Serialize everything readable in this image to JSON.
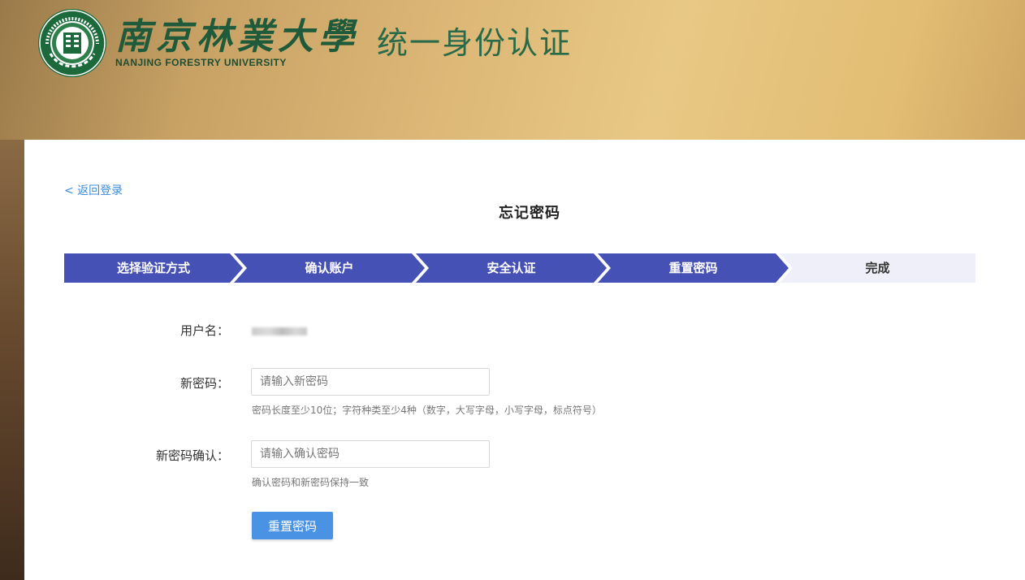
{
  "header": {
    "university_cn": "南京林業大學",
    "university_en": "NANJING FORESTRY UNIVERSITY",
    "system_title": "统一身份认证",
    "seal_text": "NANJING FORESTRY UNIVERSITY"
  },
  "colors": {
    "step_active": "#4651b5",
    "step_inactive": "#eeeff8",
    "link": "#3d8bd8",
    "button": "#4a93e4"
  },
  "nav": {
    "back_label": "< 返回登录"
  },
  "page": {
    "title": "忘记密码"
  },
  "steps": [
    {
      "label": "选择验证方式",
      "state": "done"
    },
    {
      "label": "确认账户",
      "state": "done"
    },
    {
      "label": "安全认证",
      "state": "done"
    },
    {
      "label": "重置密码",
      "state": "active"
    },
    {
      "label": "完成",
      "state": "pending"
    }
  ],
  "form": {
    "username_label": "用户名：",
    "username_value": "",
    "new_password_label": "新密码：",
    "new_password_placeholder": "请输入新密码",
    "new_password_value": "",
    "new_password_hint": "密码长度至少10位；字符种类至少4种（数字，大写字母，小写字母，标点符号）",
    "confirm_label": "新密码确认：",
    "confirm_placeholder": "请输入确认密码",
    "confirm_value": "",
    "confirm_hint": "确认密码和新密码保持一致",
    "submit_label": "重置密码"
  }
}
